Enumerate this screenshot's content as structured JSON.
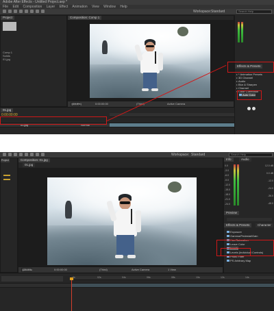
{
  "app": {
    "title": "Adobe After Effects - Untitled Project.aep *",
    "menu": [
      "File",
      "Edit",
      "Composition",
      "Layer",
      "Effect",
      "Animation",
      "View",
      "Window",
      "Help"
    ],
    "workspace_label": "Workspace:",
    "workspace_value": "Standard",
    "search_placeholder": "Search Help"
  },
  "top": {
    "comp_tab": "Composition: Comp 1",
    "project_tab": "Project",
    "project_items": [
      "Comp 1",
      "Solids",
      "01.jpg"
    ],
    "effects_tab": "Effects & Presets",
    "effects_items": [
      "* Animation Presets",
      "3D Channel",
      "Audio",
      "Blur & Sharpen",
      "Channel",
      "Color Correction",
      "Auto Color"
    ],
    "zoom": "(19.9%)",
    "timecode": "0:00:00:00",
    "quality": "(Third)",
    "view": "Active Camera",
    "layer_name": "01.jpg",
    "layer_mode": "Normal"
  },
  "bottom": {
    "comp_tab": "Composition: 01.jpg",
    "project_tab": "Project",
    "sub_tab": "01.jpg",
    "info_tab": "Info",
    "audio_tab": "Audio",
    "db_left": [
      "0.0",
      "-3.0",
      "-6.0",
      "-9.0",
      "-12.0",
      "-15.0",
      "-18.0",
      "-21.0",
      "-24.0"
    ],
    "db_right": [
      "12.0 dB",
      "0.0 dB",
      "-12.0",
      "-24.0",
      "-36.0",
      "-48.0"
    ],
    "preview_tab": "Preview",
    "effects_tab": "Effects & Presets",
    "character_tab": "Character",
    "effects_items": [
      "Exposure",
      "Gamma/Pedestal/Gain",
      "Hue/Saturation",
      "Leave Color",
      "Levels",
      "Levels (Individual Controls)",
      "Photo Filter",
      "PS Arbitrary Map"
    ],
    "zoom": "(29.9%)",
    "timecode": "0:00:00:00",
    "quality": "(Third)",
    "view": "Active Camera",
    "views": "1 View",
    "ruler_ticks": [
      "0s",
      "02s",
      "04s",
      "06s",
      "08s",
      "10s",
      "12s",
      "14s"
    ]
  },
  "colors": {
    "accent_red": "#d01818",
    "timecode": "#e8b838",
    "panel_bg": "#262626"
  }
}
